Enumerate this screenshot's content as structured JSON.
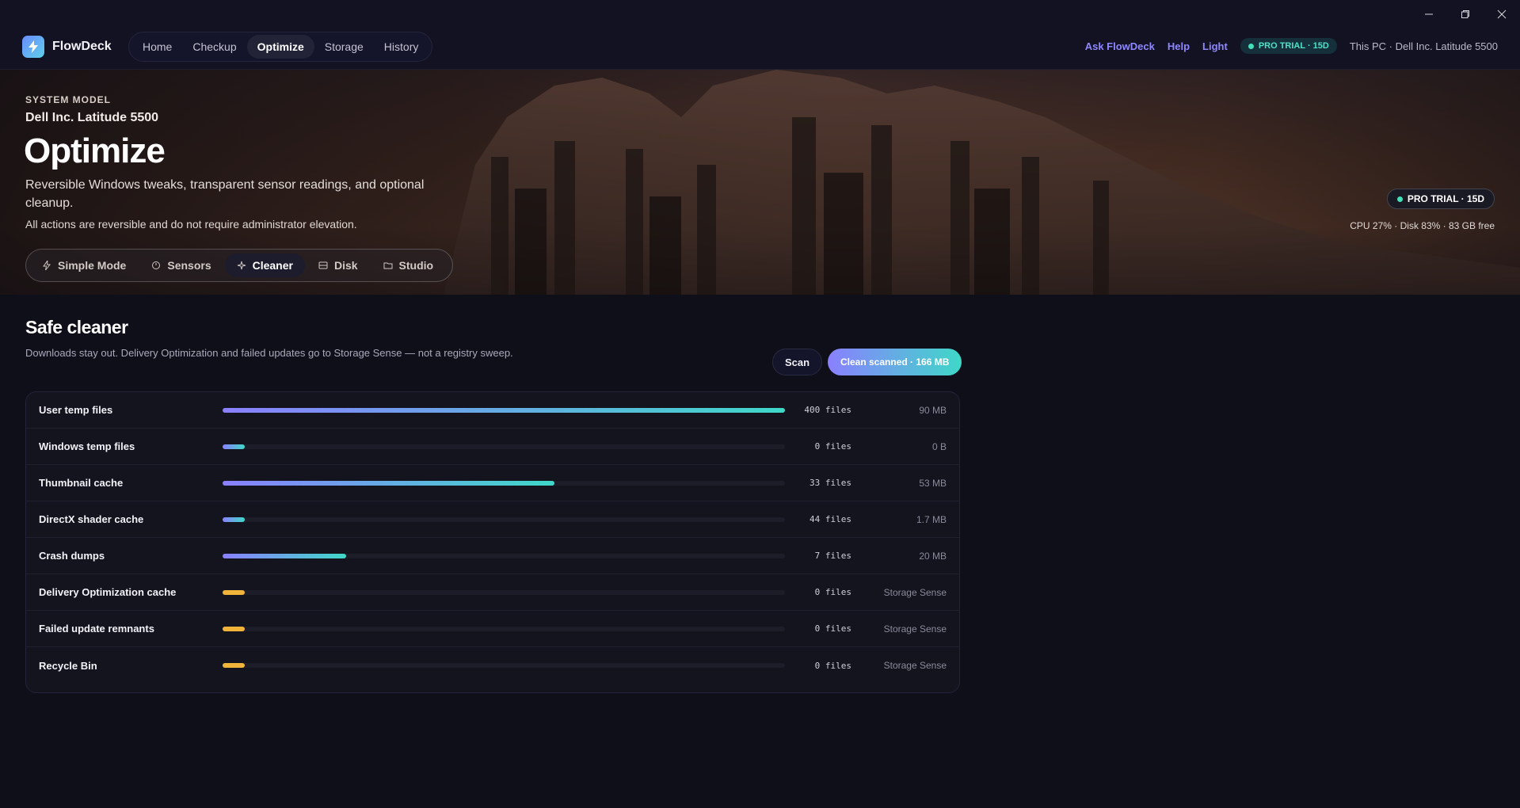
{
  "app": {
    "name": "FlowDeck"
  },
  "nav": {
    "tabs": [
      "Home",
      "Checkup",
      "Optimize",
      "Storage",
      "History"
    ],
    "active": "Optimize",
    "ask_label": "Ask FlowDeck",
    "help_label": "Help",
    "theme_label": "Light",
    "trial_badge": "PRO TRIAL · 15D",
    "pc_label": "This PC · Dell Inc. Latitude 5500"
  },
  "hero": {
    "eyebrow": "SYSTEM MODEL",
    "model": "Dell Inc. Latitude 5500",
    "title": "Optimize",
    "description": "Reversible Windows tweaks, transparent sensor readings, and optional cleanup.",
    "note": "All actions are reversible and do not require administrator elevation.",
    "trial_badge": "PRO TRIAL · 15D",
    "stats": "CPU 27% · Disk 83% · 83 GB free",
    "subtabs": [
      {
        "label": "Simple Mode",
        "icon": "bolt-icon"
      },
      {
        "label": "Sensors",
        "icon": "gauge-icon"
      },
      {
        "label": "Cleaner",
        "icon": "sparkle-icon"
      },
      {
        "label": "Disk",
        "icon": "disk-icon"
      },
      {
        "label": "Studio",
        "icon": "folder-icon"
      }
    ],
    "active_subtab": "Cleaner"
  },
  "cleaner": {
    "title": "Safe cleaner",
    "description": "Downloads stay out. Delivery Optimization and failed updates go to Storage Sense — not a registry sweep.",
    "scan_label": "Scan",
    "clean_label": "Clean scanned · 166 MB",
    "rows": [
      {
        "name": "User temp files",
        "files": "400 files",
        "size": "90 MB",
        "fill": 1.0,
        "style": "gradient"
      },
      {
        "name": "Windows temp files",
        "files": "0 files",
        "size": "0 B",
        "fill": 0.04,
        "style": "gradient"
      },
      {
        "name": "Thumbnail cache",
        "files": "33 files",
        "size": "53 MB",
        "fill": 0.59,
        "style": "gradient"
      },
      {
        "name": "DirectX shader cache",
        "files": "44 files",
        "size": "1.7 MB",
        "fill": 0.04,
        "style": "gradient"
      },
      {
        "name": "Crash dumps",
        "files": "7 files",
        "size": "20 MB",
        "fill": 0.22,
        "style": "gradient"
      },
      {
        "name": "Delivery Optimization cache",
        "files": "0 files",
        "size": "Storage Sense",
        "fill": 0.04,
        "style": "amber"
      },
      {
        "name": "Failed update remnants",
        "files": "0 files",
        "size": "Storage Sense",
        "fill": 0.04,
        "style": "amber"
      },
      {
        "name": "Recycle Bin",
        "files": "0 files",
        "size": "Storage Sense",
        "fill": 0.04,
        "style": "amber"
      }
    ]
  },
  "colors": {
    "accent_purple": "#8a80ff",
    "accent_teal": "#3fd8c8",
    "amber": "#f0b43a",
    "background": "#0f0f1a"
  }
}
